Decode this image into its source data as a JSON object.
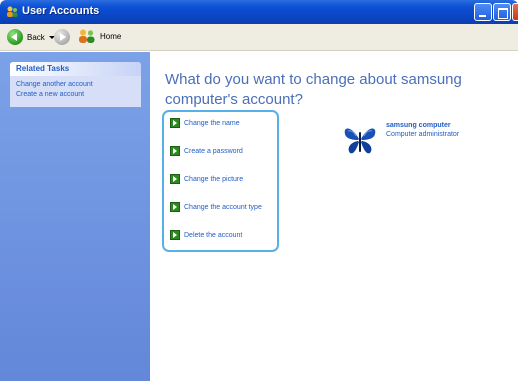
{
  "window": {
    "title": "User Accounts"
  },
  "toolbar": {
    "back_label": "Back",
    "home_label": "Home"
  },
  "sidebar": {
    "section_title": "Related Tasks",
    "items": [
      {
        "label": "Change another account"
      },
      {
        "label": "Create a new account"
      }
    ]
  },
  "main": {
    "heading": "What do you want to change about samsung computer's account?",
    "actions": [
      {
        "label": "Change the name"
      },
      {
        "label": "Create a password"
      },
      {
        "label": "Change the picture"
      },
      {
        "label": "Change the account type"
      },
      {
        "label": "Delete the account"
      }
    ],
    "account": {
      "name": "samsung computer",
      "role": "Computer administrator",
      "picture": "butterfly-icon"
    }
  },
  "colors": {
    "titlebar": "#0b4fd4",
    "sidebar": "#6f93de",
    "link": "#215dc6",
    "heading": "#4a6fb8",
    "highlight_border": "#58b0e8"
  }
}
